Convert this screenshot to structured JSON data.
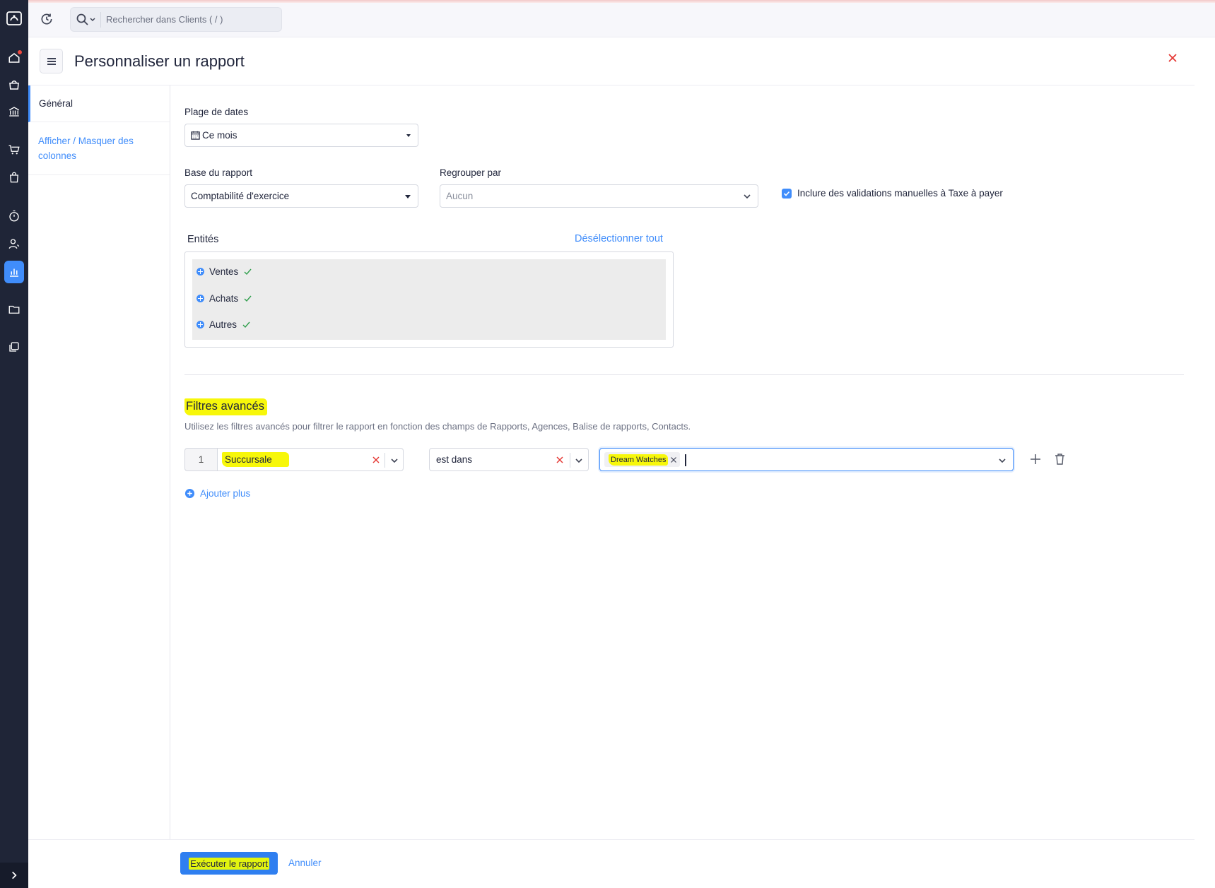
{
  "colors": {
    "accent": "#408dfb",
    "rail": "#1f2537",
    "highlight": "#f7f70a",
    "danger": "#e53935",
    "success": "#2e9e4b"
  },
  "topbar": {
    "search_placeholder": "Rechercher dans Clients ( / )"
  },
  "header": {
    "title": "Personnaliser un rapport"
  },
  "rail_icons": [
    "logo-icon",
    "home-icon",
    "items-icon",
    "bank-icon",
    "cart-icon",
    "bag-icon",
    "timer-icon",
    "contacts-icon",
    "reports-icon",
    "folder-icon",
    "documents-icon"
  ],
  "leftnav": {
    "items": [
      {
        "label": "Général"
      },
      {
        "label": "Afficher / Masquer des colonnes"
      }
    ]
  },
  "form": {
    "date_range": {
      "label": "Plage de dates",
      "value": "Ce mois"
    },
    "report_basis": {
      "label": "Base du rapport",
      "value": "Comptabilité d'exercice"
    },
    "group_by": {
      "label": "Regrouper par",
      "placeholder": "Aucun"
    },
    "include_manual": {
      "label": "Inclure des validations manuelles à Taxe à payer",
      "checked": true
    }
  },
  "entities": {
    "title": "Entités",
    "deselect_all": "Désélectionner tout",
    "items": [
      {
        "label": "Ventes"
      },
      {
        "label": "Achats"
      },
      {
        "label": "Autres"
      }
    ]
  },
  "advanced": {
    "title": "Filtres avancés",
    "description": "Utilisez les filtres avancés pour filtrer le rapport en fonction des champs de Rapports, Agences, Balise de rapports, Contacts.",
    "rows": [
      {
        "index": "1",
        "field": "Succursale",
        "operator": "est dans",
        "values": [
          "Dream Watches"
        ]
      }
    ],
    "add_more": "Ajouter plus"
  },
  "footer": {
    "run": "Exécuter le rapport",
    "cancel": "Annuler"
  }
}
